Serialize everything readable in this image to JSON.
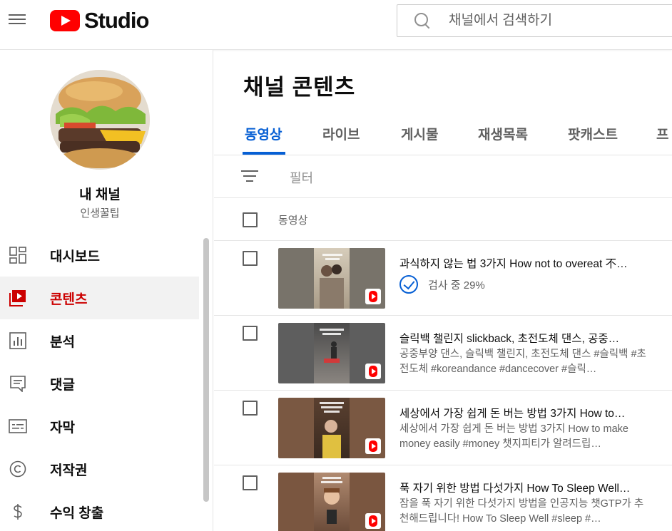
{
  "header": {
    "logo_text": "Studio",
    "search_placeholder": "채널에서 검색하기"
  },
  "channel": {
    "name": "내 채널",
    "handle": "인생꿀팁"
  },
  "sidebar": {
    "items": [
      {
        "label": "대시보드",
        "icon": "dashboard-icon",
        "active": false
      },
      {
        "label": "콘텐츠",
        "icon": "content-icon",
        "active": true
      },
      {
        "label": "분석",
        "icon": "analytics-icon",
        "active": false
      },
      {
        "label": "댓글",
        "icon": "comments-icon",
        "active": false
      },
      {
        "label": "자막",
        "icon": "subtitles-icon",
        "active": false
      },
      {
        "label": "저작권",
        "icon": "copyright-icon",
        "active": false
      },
      {
        "label": "수익 창출",
        "icon": "monetization-icon",
        "active": false
      }
    ]
  },
  "main": {
    "title": "채널 콘텐츠",
    "tabs": [
      {
        "label": "동영상",
        "active": true
      },
      {
        "label": "라이브",
        "active": false
      },
      {
        "label": "게시물",
        "active": false
      },
      {
        "label": "재생목록",
        "active": false
      },
      {
        "label": "팟캐스트",
        "active": false
      },
      {
        "label": "프",
        "active": false
      }
    ],
    "filter_label": "필터",
    "column_header": "동영상",
    "videos": [
      {
        "title": "과식하지 않는 법 3가지 How not to overeat 不…",
        "status_text": "검사 중 29%",
        "progress_percent": 29,
        "thumb_colors": [
          "#78736a",
          "#c2b8a6"
        ]
      },
      {
        "title": "슬릭백 챌린지 slickback, 초전도체 댄스, 공중…",
        "description": "공중부양 댄스, 슬릭백 챌린지, 초전도체 댄스 #슬릭백 #초전도체 #koreandance #dancecover #슬릭…",
        "thumb_colors": [
          "#5e5e5e",
          "#8a8580"
        ]
      },
      {
        "title": "세상에서 가장 쉽게 돈 버는 방법 3가지 How to…",
        "description": "세상에서 가장 쉽게 돈 버는 방법 3가지 How to make money easily #money 챗지피티가 알려드립…",
        "thumb_colors": [
          "#7a5842",
          "#a88a6c"
        ]
      },
      {
        "title": "푹 자기 위한 방법 다섯가지 How To Sleep Well…",
        "description": "잠을 푹 자기 위한 다섯가지 방법을 인공지능 챗GTP가 추천해드립니다! How To Sleep Well #sleep #…",
        "thumb_colors": [
          "#7a5640",
          "#b08a70"
        ]
      }
    ]
  }
}
